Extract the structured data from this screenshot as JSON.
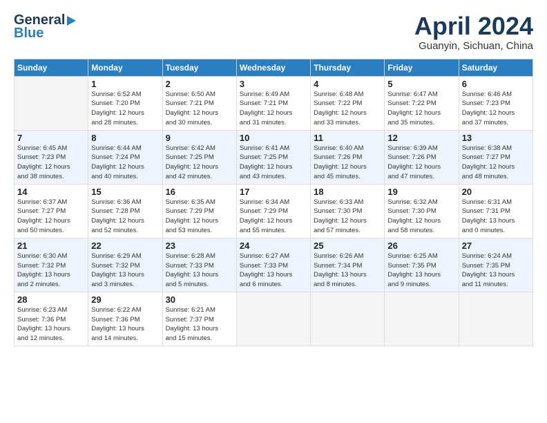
{
  "header": {
    "logo_line1": "General",
    "logo_line2": "Blue",
    "month": "April 2024",
    "location": "Guanyin, Sichuan, China"
  },
  "weekdays": [
    "Sunday",
    "Monday",
    "Tuesday",
    "Wednesday",
    "Thursday",
    "Friday",
    "Saturday"
  ],
  "weeks": [
    [
      {
        "day": "",
        "sunrise": "",
        "sunset": "",
        "daylight": ""
      },
      {
        "day": "1",
        "sunrise": "Sunrise: 6:52 AM",
        "sunset": "Sunset: 7:20 PM",
        "daylight": "Daylight: 12 hours and 28 minutes."
      },
      {
        "day": "2",
        "sunrise": "Sunrise: 6:50 AM",
        "sunset": "Sunset: 7:21 PM",
        "daylight": "Daylight: 12 hours and 30 minutes."
      },
      {
        "day": "3",
        "sunrise": "Sunrise: 6:49 AM",
        "sunset": "Sunset: 7:21 PM",
        "daylight": "Daylight: 12 hours and 31 minutes."
      },
      {
        "day": "4",
        "sunrise": "Sunrise: 6:48 AM",
        "sunset": "Sunset: 7:22 PM",
        "daylight": "Daylight: 12 hours and 33 minutes."
      },
      {
        "day": "5",
        "sunrise": "Sunrise: 6:47 AM",
        "sunset": "Sunset: 7:22 PM",
        "daylight": "Daylight: 12 hours and 35 minutes."
      },
      {
        "day": "6",
        "sunrise": "Sunrise: 6:46 AM",
        "sunset": "Sunset: 7:23 PM",
        "daylight": "Daylight: 12 hours and 37 minutes."
      }
    ],
    [
      {
        "day": "7",
        "sunrise": "Sunrise: 6:45 AM",
        "sunset": "Sunset: 7:23 PM",
        "daylight": "Daylight: 12 hours and 38 minutes."
      },
      {
        "day": "8",
        "sunrise": "Sunrise: 6:44 AM",
        "sunset": "Sunset: 7:24 PM",
        "daylight": "Daylight: 12 hours and 40 minutes."
      },
      {
        "day": "9",
        "sunrise": "Sunrise: 6:42 AM",
        "sunset": "Sunset: 7:25 PM",
        "daylight": "Daylight: 12 hours and 42 minutes."
      },
      {
        "day": "10",
        "sunrise": "Sunrise: 6:41 AM",
        "sunset": "Sunset: 7:25 PM",
        "daylight": "Daylight: 12 hours and 43 minutes."
      },
      {
        "day": "11",
        "sunrise": "Sunrise: 6:40 AM",
        "sunset": "Sunset: 7:26 PM",
        "daylight": "Daylight: 12 hours and 45 minutes."
      },
      {
        "day": "12",
        "sunrise": "Sunrise: 6:39 AM",
        "sunset": "Sunset: 7:26 PM",
        "daylight": "Daylight: 12 hours and 47 minutes."
      },
      {
        "day": "13",
        "sunrise": "Sunrise: 6:38 AM",
        "sunset": "Sunset: 7:27 PM",
        "daylight": "Daylight: 12 hours and 48 minutes."
      }
    ],
    [
      {
        "day": "14",
        "sunrise": "Sunrise: 6:37 AM",
        "sunset": "Sunset: 7:27 PM",
        "daylight": "Daylight: 12 hours and 50 minutes."
      },
      {
        "day": "15",
        "sunrise": "Sunrise: 6:36 AM",
        "sunset": "Sunset: 7:28 PM",
        "daylight": "Daylight: 12 hours and 52 minutes."
      },
      {
        "day": "16",
        "sunrise": "Sunrise: 6:35 AM",
        "sunset": "Sunset: 7:29 PM",
        "daylight": "Daylight: 12 hours and 53 minutes."
      },
      {
        "day": "17",
        "sunrise": "Sunrise: 6:34 AM",
        "sunset": "Sunset: 7:29 PM",
        "daylight": "Daylight: 12 hours and 55 minutes."
      },
      {
        "day": "18",
        "sunrise": "Sunrise: 6:33 AM",
        "sunset": "Sunset: 7:30 PM",
        "daylight": "Daylight: 12 hours and 57 minutes."
      },
      {
        "day": "19",
        "sunrise": "Sunrise: 6:32 AM",
        "sunset": "Sunset: 7:30 PM",
        "daylight": "Daylight: 12 hours and 58 minutes."
      },
      {
        "day": "20",
        "sunrise": "Sunrise: 6:31 AM",
        "sunset": "Sunset: 7:31 PM",
        "daylight": "Daylight: 13 hours and 0 minutes."
      }
    ],
    [
      {
        "day": "21",
        "sunrise": "Sunrise: 6:30 AM",
        "sunset": "Sunset: 7:32 PM",
        "daylight": "Daylight: 13 hours and 2 minutes."
      },
      {
        "day": "22",
        "sunrise": "Sunrise: 6:29 AM",
        "sunset": "Sunset: 7:32 PM",
        "daylight": "Daylight: 13 hours and 3 minutes."
      },
      {
        "day": "23",
        "sunrise": "Sunrise: 6:28 AM",
        "sunset": "Sunset: 7:33 PM",
        "daylight": "Daylight: 13 hours and 5 minutes."
      },
      {
        "day": "24",
        "sunrise": "Sunrise: 6:27 AM",
        "sunset": "Sunset: 7:33 PM",
        "daylight": "Daylight: 13 hours and 6 minutes."
      },
      {
        "day": "25",
        "sunrise": "Sunrise: 6:26 AM",
        "sunset": "Sunset: 7:34 PM",
        "daylight": "Daylight: 13 hours and 8 minutes."
      },
      {
        "day": "26",
        "sunrise": "Sunrise: 6:25 AM",
        "sunset": "Sunset: 7:35 PM",
        "daylight": "Daylight: 13 hours and 9 minutes."
      },
      {
        "day": "27",
        "sunrise": "Sunrise: 6:24 AM",
        "sunset": "Sunset: 7:35 PM",
        "daylight": "Daylight: 13 hours and 11 minutes."
      }
    ],
    [
      {
        "day": "28",
        "sunrise": "Sunrise: 6:23 AM",
        "sunset": "Sunset: 7:36 PM",
        "daylight": "Daylight: 13 hours and 12 minutes."
      },
      {
        "day": "29",
        "sunrise": "Sunrise: 6:22 AM",
        "sunset": "Sunset: 7:36 PM",
        "daylight": "Daylight: 13 hours and 14 minutes."
      },
      {
        "day": "30",
        "sunrise": "Sunrise: 6:21 AM",
        "sunset": "Sunset: 7:37 PM",
        "daylight": "Daylight: 13 hours and 15 minutes."
      },
      {
        "day": "",
        "sunrise": "",
        "sunset": "",
        "daylight": ""
      },
      {
        "day": "",
        "sunrise": "",
        "sunset": "",
        "daylight": ""
      },
      {
        "day": "",
        "sunrise": "",
        "sunset": "",
        "daylight": ""
      },
      {
        "day": "",
        "sunrise": "",
        "sunset": "",
        "daylight": ""
      }
    ]
  ]
}
